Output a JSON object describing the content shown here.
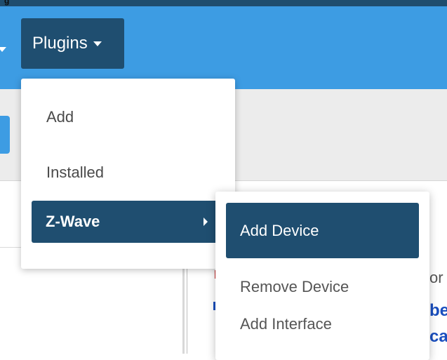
{
  "top_strip_text": "g",
  "navbar": {
    "plugins_label": "Plugins"
  },
  "plugins_menu": {
    "items": [
      {
        "label": "Add"
      },
      {
        "label": "Installed"
      },
      {
        "label": "Z-Wave"
      }
    ],
    "active_item": "Z-Wave"
  },
  "zwave_submenu": {
    "items": [
      {
        "label": "Add Device"
      },
      {
        "label": "Remove Device"
      },
      {
        "label": "Add Interface"
      }
    ],
    "highlighted_item": "Add Device"
  },
  "background_peek": {
    "line1": "or",
    "line2": "be",
    "line3": "ca"
  },
  "colors": {
    "navbar": "#3d9ce3",
    "dark_blue": "#1f4e70",
    "subbar": "#ececec"
  }
}
